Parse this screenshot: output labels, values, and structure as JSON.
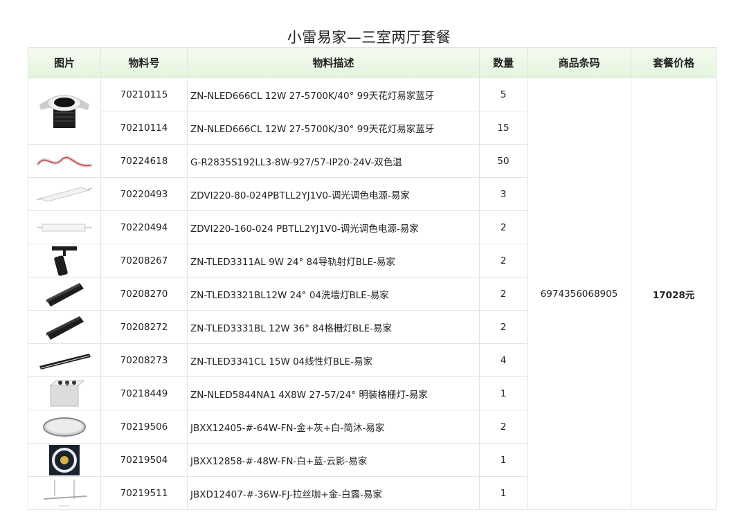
{
  "title": "小雷易家—三室两厅套餐",
  "headers": {
    "image": "图片",
    "item_no": "物料号",
    "desc": "物料描述",
    "qty": "数量",
    "barcode": "商品条码",
    "price": "套餐价格"
  },
  "barcode": "6974356068905",
  "price": "17028元",
  "rows": [
    {
      "no": "70210115",
      "desc": "ZN-NLED666CL 12W 27-5700K/40° 99天花灯易家蓝牙",
      "qty": "5"
    },
    {
      "no": "70210114",
      "desc": "ZN-NLED666CL 12W 27-5700K/30° 99天花灯易家蓝牙",
      "qty": "15"
    },
    {
      "no": "70224618",
      "desc": "G-R2835S192LL3-8W-927/57-IP20-24V-双色温",
      "qty": "50"
    },
    {
      "no": "70220493",
      "desc": "ZDVI220-80-024PBTLL2YJ1V0-调光调色电源-易家",
      "qty": "3"
    },
    {
      "no": "70220494",
      "desc": "ZDVI220-160-024 PBTLL2YJ1V0-调光调色电源-易家",
      "qty": "2"
    },
    {
      "no": "70208267",
      "desc": "ZN-TLED3311AL 9W 24° 84导轨射灯BLE-易家",
      "qty": "2"
    },
    {
      "no": "70208270",
      "desc": "ZN-TLED3321BL12W 24° 04洗墙灯BLE-易家",
      "qty": "2"
    },
    {
      "no": "70208272",
      "desc": "ZN-TLED3331BL 12W 36° 84格栅灯BLE-易家",
      "qty": "2"
    },
    {
      "no": "70208273",
      "desc": "ZN-TLED3341CL 15W 04线性灯BLE-易家",
      "qty": "4"
    },
    {
      "no": "70218449",
      "desc": "ZN-NLED5844NA1 4X8W 27-57/24° 明装格栅灯-易家",
      "qty": "1"
    },
    {
      "no": "70219506",
      "desc": "JBXX12405-#-64W-FN-金+灰+白-简沐-易家",
      "qty": "2"
    },
    {
      "no": "70219504",
      "desc": "JBXX12858-#-48W-FN-白+蓝-云影-易家",
      "qty": "1"
    },
    {
      "no": "70219511",
      "desc": "JBXD12407-#-36W-FJ-拉丝咖+金-白露-易家",
      "qty": "1"
    }
  ]
}
